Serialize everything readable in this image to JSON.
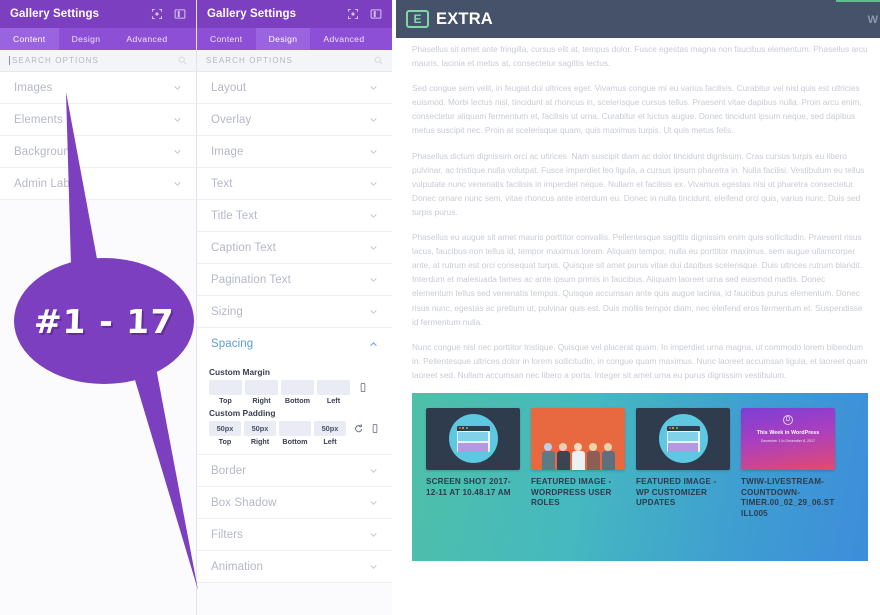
{
  "panels": {
    "left": {
      "title": "Gallery Settings",
      "icons": [
        "move-icon",
        "panel-layout-icon"
      ],
      "tabs": [
        {
          "label": "Content",
          "active": true
        },
        {
          "label": "Design",
          "active": false
        },
        {
          "label": "Advanced",
          "active": false
        }
      ],
      "search_placeholder": "SEARCH OPTIONS",
      "sections": [
        {
          "label": "Images",
          "open": false
        },
        {
          "label": "Elements",
          "open": false
        },
        {
          "label": "Background",
          "open": false
        },
        {
          "label": "Admin Label",
          "open": false
        }
      ]
    },
    "right": {
      "title": "Gallery Settings",
      "icons": [
        "move-icon",
        "panel-layout-icon"
      ],
      "tabs": [
        {
          "label": "Content",
          "active": false
        },
        {
          "label": "Design",
          "active": true
        },
        {
          "label": "Advanced",
          "active": false
        }
      ],
      "search_placeholder": "SEARCH OPTIONS",
      "sections_before": [
        {
          "label": "Layout",
          "open": false
        },
        {
          "label": "Overlay",
          "open": false
        },
        {
          "label": "Image",
          "open": false
        },
        {
          "label": "Text",
          "open": false
        },
        {
          "label": "Title Text",
          "open": false
        },
        {
          "label": "Caption Text",
          "open": false
        },
        {
          "label": "Pagination Text",
          "open": false
        },
        {
          "label": "Sizing",
          "open": false
        }
      ],
      "spacing": {
        "label": "Spacing",
        "open": true,
        "margin": {
          "label": "Custom Margin",
          "fields": [
            {
              "caption": "Top",
              "value": ""
            },
            {
              "caption": "Right",
              "value": ""
            },
            {
              "caption": "Bottom",
              "value": ""
            },
            {
              "caption": "Left",
              "value": ""
            }
          ],
          "tools": [
            "responsive-icon"
          ]
        },
        "padding": {
          "label": "Custom Padding",
          "fields": [
            {
              "caption": "Top",
              "value": "50px"
            },
            {
              "caption": "Right",
              "value": "50px"
            },
            {
              "caption": "Bottom",
              "value": ""
            },
            {
              "caption": "Left",
              "value": "50px"
            }
          ],
          "tools": [
            "reset-icon",
            "responsive-icon"
          ]
        }
      },
      "sections_after": [
        {
          "label": "Border",
          "open": false
        },
        {
          "label": "Box Shadow",
          "open": false
        },
        {
          "label": "Filters",
          "open": false
        },
        {
          "label": "Animation",
          "open": false
        }
      ]
    }
  },
  "callout": {
    "text": "#1 - 17",
    "color": "#7b3fbf"
  },
  "preview": {
    "brand": "EXTRA",
    "logo_letter": "E",
    "corner_mark": "W",
    "paragraphs": [
      "Phasellus sit amet ante fringilla, cursus elit at, tempus dolor. Fusce egestas magna non faucibus elementum. Phasellus arcu mauris, lacinia et metus at, consectetur sagittis lectus.",
      "Sed congue sem velit, in feugiat dui ultrices eget. Vivamus congue mi eu varius facilisis. Curabitur vel nisl quis est ultricies euismod. Morbi lectus nisl, tincidunt at rhoncus in, scelerisque cursus tellus. Praesent vitae dapibus nulla. Proin arcu enim, consectetur aliquam fermentum et, facilisis ut urna. Curabitur et luctus augue. Donec tincidunt ipsum neque, sed dapibus metus suscipit nec. Proin at scelerisque quam, quis maximus turpis. Ut quis metus felis.",
      "Phasellus dictum dignissim orci ac ultrices. Nam suscipit diam ac dolor tincidunt dignissim. Cras cursus turpis eu libero pulvinar, ac tristique nulla volutpat. Fusce imperdiet leo ligula, a cursus ipsum pharetra in. Nulla facilisi. Vestibulum eu tellus vulputate nunc venenatis facilisis in imperdiet neque. Nullam et facilisis ex. Vivamus egestas nisi ut pharetra consectetur. Donec ornare nunc sem, vitae rhoncus ante interdum eu. Donec in nulla tincidunt, eleifend orci quis, varius nunc. Duis sed turpis purus.",
      "Phasellus eu augue sit amet mauris porttitor convallis. Pellentesque sagittis dignissim enim quis sollicitudin. Praesent risus lacus, faucibus non tellus id, tempor maximus lorem. Aliquam tempor, nulla eu porttitor maximus, sem augue ullamcorper ante, at rutrum est orci consequat turpis. Quisque sit amet purus vitae dui dapibus scelerisque. Duis ultrices rutrum blandit. Interdum et malesuada fames ac ante ipsum primis in faucibus. Aliquam laoreet urna sed euismod mattis. Donec elementum tellus sed venenatis tempus. Quisque accumsan ante quis augue lacinia, id faucibus purus elementum. Donec risus nunc, egestas ac pretium ut, pulvinar quis est. Duis mollis tempor diam, nec eleifend eros fermentum et. Suspendisse id fermentum nulla.",
      "Nunc congue nisl nec porttitor tristique. Quisque vel placerat quam. In imperdiet urna magna, ut commodo lorem bibendum in. Pellentesque ultrices dolor in lorem sollicitudin, in congue quam maximus. Nunc laoreet accumsan ligula, et laoreet quam laoreet sed. Nullam accumsan nec libero a porta. Integer sit amet urna eu purus dignissim vestibulum."
    ],
    "gallery": {
      "gradient_from": "#4fc0a8",
      "gradient_to": "#3d8ddb",
      "items": [
        {
          "caption": "SCREEN SHOT 2017-12-11 AT 10.48.17 AM",
          "style": "dark-browser"
        },
        {
          "caption": "FEATURED IMAGE - WORDPRESS USER ROLES",
          "style": "orange-people"
        },
        {
          "caption": "FEATURED IMAGE - WP CUSTOMIZER UPDATES",
          "style": "dark-browser"
        },
        {
          "caption": "TWIW-LIVESTREAM-COUNTDOWN-TIMER.00_02_29_06.STILL005",
          "style": "gradient-card",
          "card_title": "This Week in WordPress",
          "card_sub": "December 1 to December 8, 2017",
          "card_badge": "D"
        }
      ]
    }
  }
}
